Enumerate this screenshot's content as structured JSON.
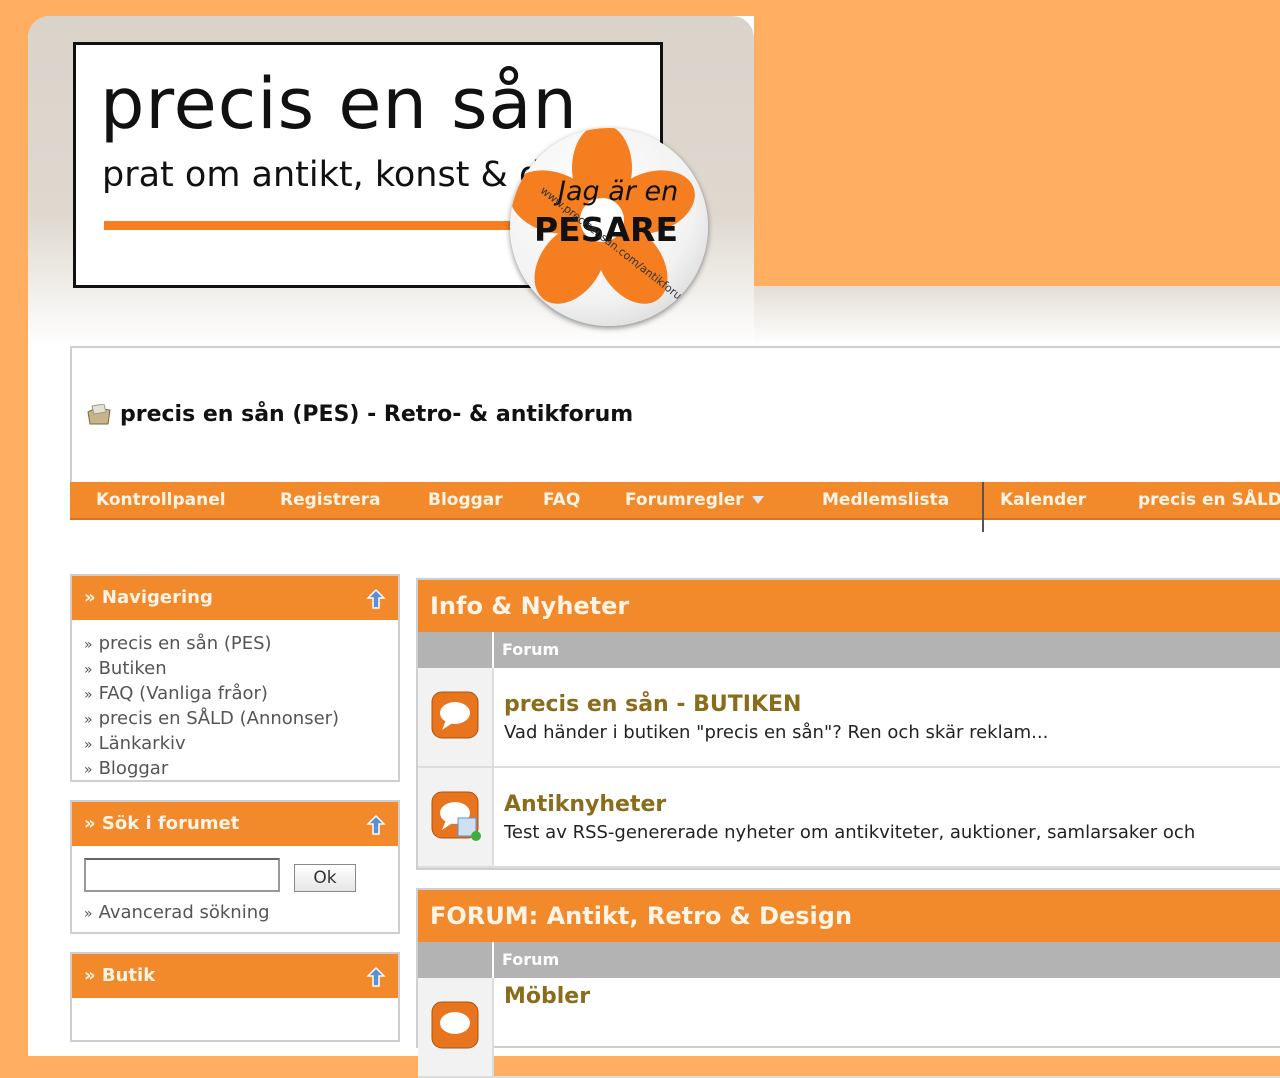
{
  "header": {
    "logo_title": "precis en sån",
    "logo_subtitle": "prat om antikt, konst & d",
    "badge_line1": "Jag är en",
    "badge_line2": "PESARE",
    "badge_ring": "www.precisensan.com/antikforum"
  },
  "site_title": "precis en sån (PES) - Retro- & antikforum",
  "navbar": {
    "items": [
      "Kontrollpanel",
      "Registrera",
      "Bloggar",
      "FAQ",
      "Forumregler",
      "Medlemslista",
      "Kalender",
      "precis en SÅLD"
    ]
  },
  "sidebar": {
    "navigation": {
      "title": "» Navigering",
      "items": [
        "precis en sån (PES)",
        "Butiken",
        "FAQ (Vanliga fråor)",
        "precis en SÅLD (Annonser)",
        "Länkarkiv",
        "Bloggar"
      ]
    },
    "search": {
      "title": "» Sök i forumet",
      "button": "Ok",
      "advanced": "Avancerad sökning"
    },
    "shop": {
      "title": "» Butik"
    }
  },
  "forums": [
    {
      "title": "Info & Nyheter",
      "column": "Forum",
      "rows": [
        {
          "name": "precis en sån - BUTIKEN",
          "desc": "Vad händer i butiken \"precis en sån\"? Ren och skär reklam..."
        },
        {
          "name": "Antiknyheter",
          "desc": "Test av RSS-genererade nyheter om antikviteter, auktioner, samlarsaker och"
        }
      ]
    },
    {
      "title": "FORUM: Antikt, Retro & Design",
      "column": "Forum",
      "rows": [
        {
          "name": "Möbler",
          "desc": ""
        }
      ]
    }
  ],
  "colors": {
    "background": "#ffae62",
    "accent": "#f28a2b",
    "forum_name": "#8a6d1c"
  }
}
